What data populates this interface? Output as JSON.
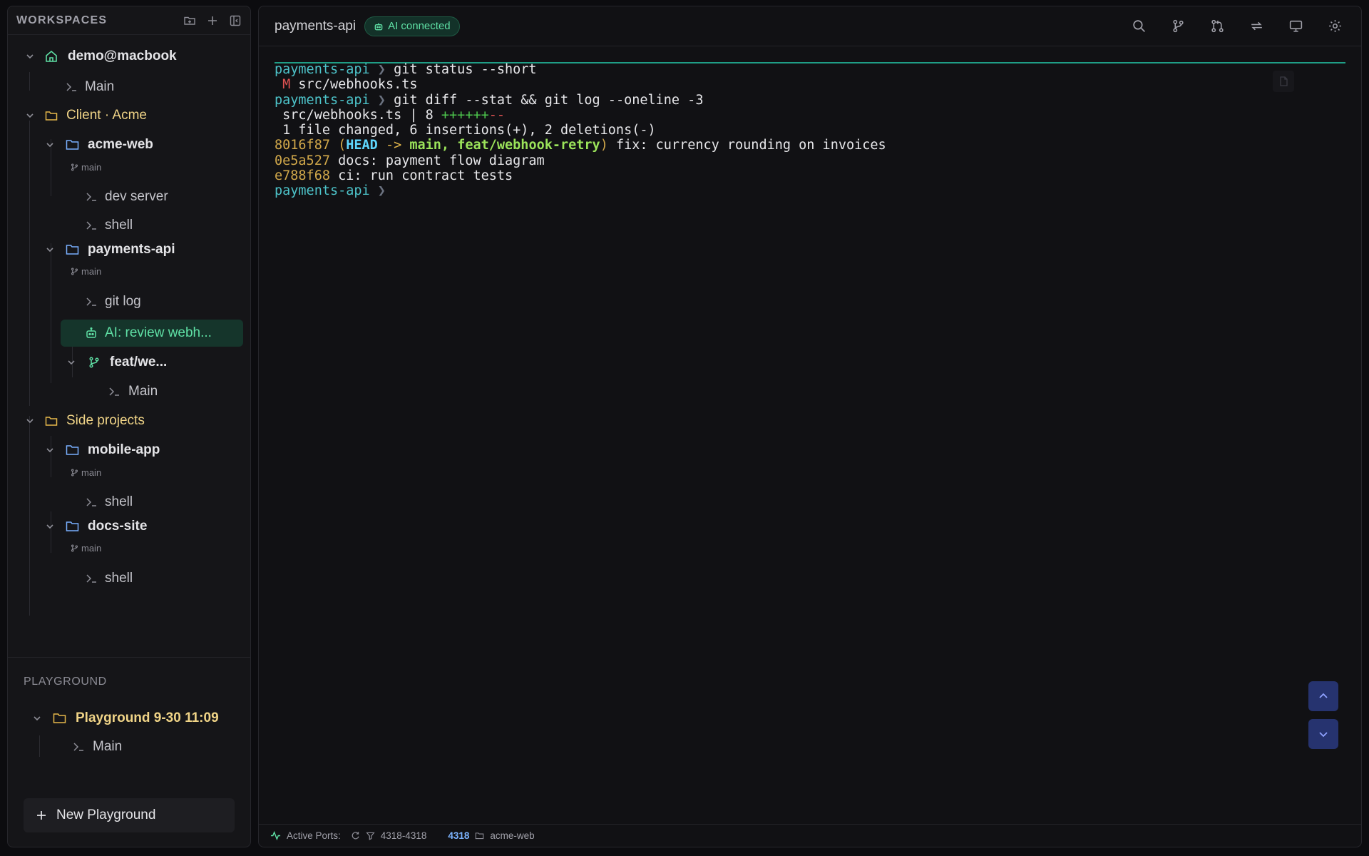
{
  "sidebar": {
    "title": "WORKSPACES",
    "tree": {
      "host": {
        "label": "demo@macbook",
        "children": [
          "Main"
        ]
      },
      "group_acme": {
        "label": "Client · Acme"
      },
      "acme_web": {
        "label": "acme-web",
        "branch": "main",
        "sessions": [
          "dev server",
          "shell"
        ]
      },
      "payments_api": {
        "label": "payments-api",
        "branch": "main",
        "sessions": [
          "git log",
          "AI: review webh..."
        ]
      },
      "worktree": {
        "label": "feat/we...",
        "sessions": [
          "Main"
        ]
      },
      "group_side": {
        "label": "Side projects"
      },
      "mobile_app": {
        "label": "mobile-app",
        "branch": "main",
        "sessions": [
          "shell"
        ]
      },
      "docs_site": {
        "label": "docs-site",
        "branch": "main",
        "sessions": [
          "shell"
        ]
      }
    },
    "playground": {
      "title": "PLAYGROUND",
      "folder": "Playground 9-30 11:09",
      "sessions": [
        "Main"
      ],
      "new_button": "New Playground"
    }
  },
  "main": {
    "tab_title": "payments-api",
    "ai_badge": "AI connected",
    "terminal": {
      "prompt": "payments-api",
      "lines": {
        "cmd1": "git status --short",
        "status_flag": "M",
        "status_file": "src/webhooks.ts",
        "cmd2": "git diff --stat && git log --oneline -3",
        "diffstat_file": " src/webhooks.ts | 8 ",
        "diffstat_plus": "++++++",
        "diffstat_minus": "--",
        "summary": " 1 file changed, 6 insertions(+), 2 deletions(-)",
        "log1_hash": "8016f87",
        "log1_head": "HEAD",
        "log1_arrow": " -> ",
        "log1_branches": "main, feat/webhook-retry",
        "log1_msg": " fix: currency rounding on invoices",
        "log2_hash": "0e5a527",
        "log2_msg": " docs: payment flow diagram",
        "log3_hash": "e788f68",
        "log3_msg": " ci: run contract tests"
      }
    },
    "statusbar": {
      "label": "Active Ports:",
      "range": "4318-4318",
      "port": "4318",
      "project": "acme-web"
    }
  },
  "colors": {
    "accent_green": "#5fe0a5",
    "folder_blue": "#7ab0ff",
    "folder_amber": "#e6b84a",
    "active_bg": "#15352b"
  }
}
